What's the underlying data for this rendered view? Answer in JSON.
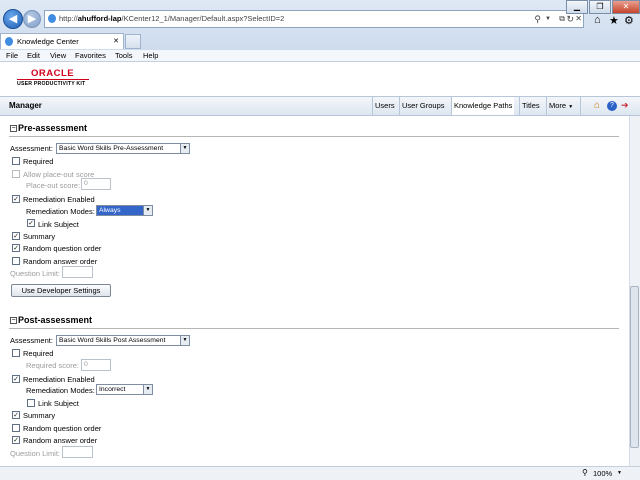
{
  "browser": {
    "url_prefix": "http://",
    "url_host": "ahufford-lap",
    "url_path": "/KCenter12_1/Manager/Default.aspx?SelectID=2",
    "tab_title": "Knowledge Center",
    "menu": [
      "File",
      "Edit",
      "View",
      "Favorites",
      "Tools",
      "Help"
    ]
  },
  "logo": {
    "brand": "ORACLE",
    "product": "USER PRODUCTIVITY KIT"
  },
  "nav": {
    "title": "Manager",
    "links": [
      "Users",
      "User Groups",
      "Knowledge Paths",
      "Titles",
      "More"
    ]
  },
  "pre": {
    "title": "Pre-assessment",
    "assessment_label": "Assessment:",
    "assessment_value": "Basic Word Skills Pre-Assessment",
    "required": "Required",
    "allow_placeout": "Allow place-out score",
    "placeout_label": "Place-out score:",
    "placeout_value": "0",
    "remediation_enabled": "Remediation Enabled",
    "remediation_modes_label": "Remediation Modes:",
    "remediation_modes_value": "Always",
    "link_subject": "Link Subject",
    "summary": "Summary",
    "random_question": "Random question order",
    "random_answer": "Random answer order",
    "question_limit": "Question Limit:",
    "dev_button": "Use Developer Settings"
  },
  "post": {
    "title": "Post-assessment",
    "assessment_label": "Assessment:",
    "assessment_value": "Basic Word Skills Post Assessment",
    "required": "Required",
    "required_score_label": "Required score:",
    "required_score_value": "0",
    "remediation_enabled": "Remediation Enabled",
    "remediation_modes_label": "Remediation Modes:",
    "remediation_modes_value": "Incorrect",
    "link_subject": "Link Subject",
    "summary": "Summary",
    "random_question": "Random question order",
    "random_answer": "Random answer order",
    "question_limit": "Question Limit:"
  },
  "status": {
    "zoom": "100%"
  }
}
